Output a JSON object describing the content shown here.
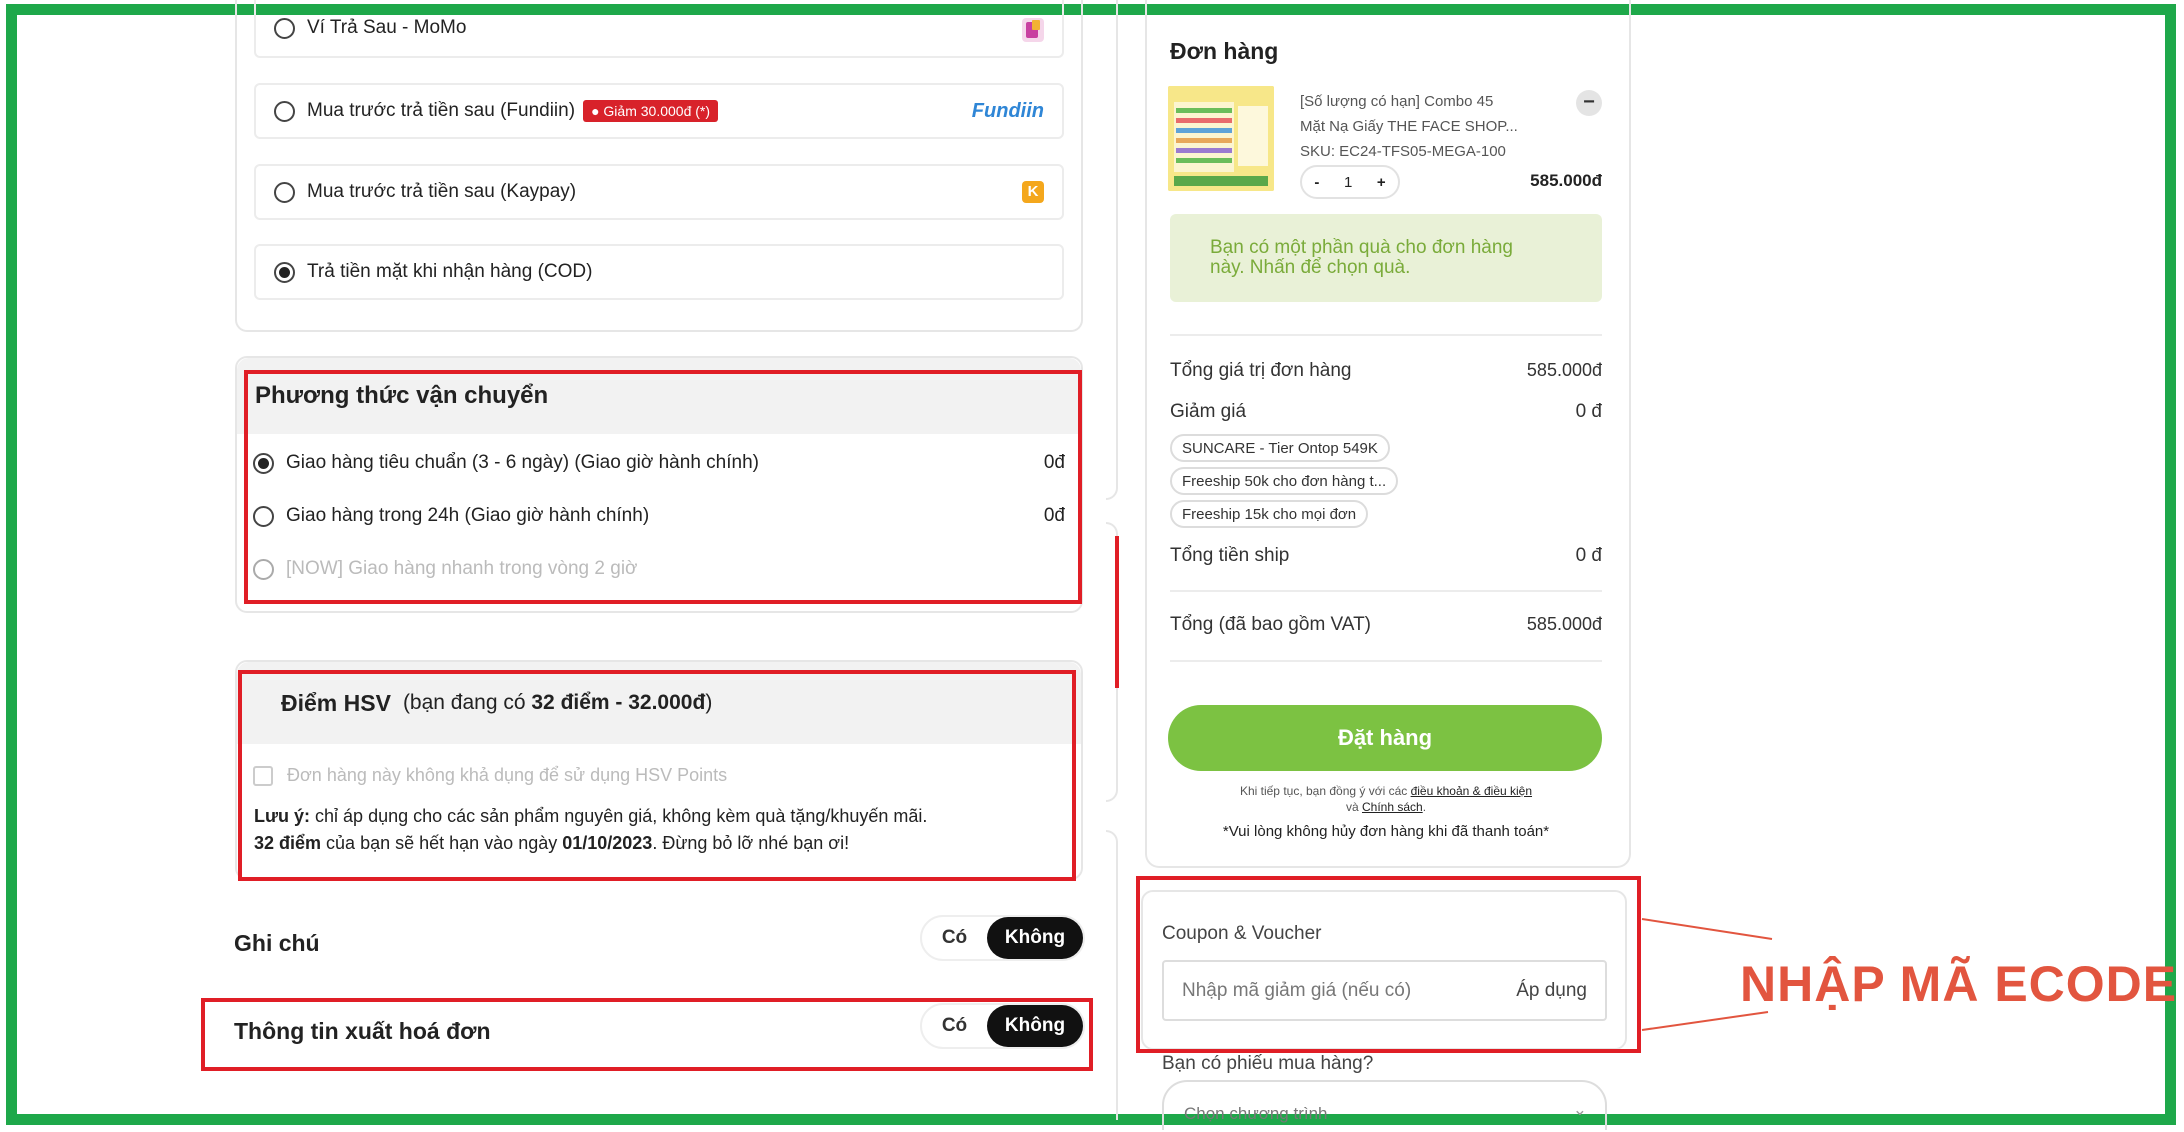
{
  "payment": {
    "options": [
      {
        "label": "Ví Trả Sau - MoMo",
        "selected": false
      },
      {
        "label": "Mua trước trả tiền sau (Fundiin)",
        "selected": false,
        "badge": "Giảm 30.000đ (*)",
        "logo": "Fundiin"
      },
      {
        "label": "Mua trước trả tiền sau (Kaypay)",
        "selected": false,
        "logo": "K"
      },
      {
        "label": "Trả tiền mặt khi nhận hàng (COD)",
        "selected": true
      }
    ]
  },
  "shipping": {
    "title": "Phương thức vận chuyển",
    "options": [
      {
        "label": "Giao hàng tiêu chuẩn (3 - 6 ngày) (Giao giờ hành chính)",
        "price": "0đ",
        "selected": true
      },
      {
        "label": "Giao hàng trong 24h (Giao giờ hành chính)",
        "price": "0đ",
        "selected": false
      },
      {
        "label": "[NOW] Giao hàng nhanh trong vòng 2 giờ",
        "price": "",
        "selected": false,
        "disabled": true
      }
    ]
  },
  "points": {
    "title": "Điểm HSV",
    "subtitle_prefix": "(bạn đang có ",
    "subtitle_bold": "32 điểm - 32.000đ",
    "subtitle_suffix": ")",
    "checkbox_label": "Đơn hàng này không khả dụng để sử dụng HSV Points",
    "note_label": "Lưu ý:",
    "note_text": " chỉ áp dụng cho các sản phẩm nguyên giá, không kèm quà tặng/khuyến mãi.",
    "expiry_points": "32 điểm",
    "expiry_mid": " của bạn sẽ hết hạn vào ngày ",
    "expiry_date": "01/10/2023",
    "expiry_end": ". Đừng bỏ lỡ nhé bạn ơi!"
  },
  "note": {
    "title": "Ghi chú",
    "yes": "Có",
    "no": "Không"
  },
  "invoice": {
    "title": "Thông tin xuất hoá đơn",
    "yes": "Có",
    "no": "Không"
  },
  "order": {
    "title": "Đơn hàng",
    "product_name_1": "[Số lượng có hạn] Combo 45",
    "product_name_2": "Mặt Nạ Giấy THE FACE SHOP...",
    "sku": "SKU: EC24-TFS05-MEGA-100",
    "qty_minus": "-",
    "qty": "1",
    "qty_plus": "+",
    "price": "585.000đ",
    "gift_text_1": "Bạn có một phần quà cho đơn hàng",
    "gift_text_2": "này. Nhấn để chọn quà.",
    "subtotal_label": "Tổng giá trị đơn hàng",
    "subtotal_value": "585.000đ",
    "discount_label": "Giảm giá",
    "discount_value": "0 đ",
    "coupons": [
      "SUNCARE - Tier Ontop 549K",
      "Freeship 50k cho đơn hàng t...",
      "Freeship 15k cho mọi đơn"
    ],
    "shipfee_label": "Tổng tiền ship",
    "shipfee_value": "0 đ",
    "total_label": "Tổng (đã bao gồm VAT)",
    "total_value": "585.000đ",
    "place_order": "Đặt hàng",
    "terms_prefix": "Khi tiếp tục, bạn đồng ý với các ",
    "terms_link": "điều khoản & điều kiện",
    "terms_mid": "và ",
    "policy_link": "Chính sách",
    "terms_end": ".",
    "warning": "*Vui lòng không hủy đơn hàng khi đã thanh toán*"
  },
  "coupon": {
    "title": "Coupon & Voucher",
    "placeholder": "Nhập mã giảm giá (nếu có)",
    "apply": "Áp dụng",
    "voucher_question": "Bạn có phiếu mua hàng?",
    "select_placeholder": "Chọn chương trình"
  },
  "annotation": {
    "text": "NHẬP MÃ ECODE",
    "color": "#e2553f"
  },
  "colors": {
    "frame": "#1ea84a",
    "highlight": "#e01e26",
    "primary": "#7cc242",
    "gift_bg": "#e9f1d7",
    "gift_text": "#7aab3a"
  }
}
